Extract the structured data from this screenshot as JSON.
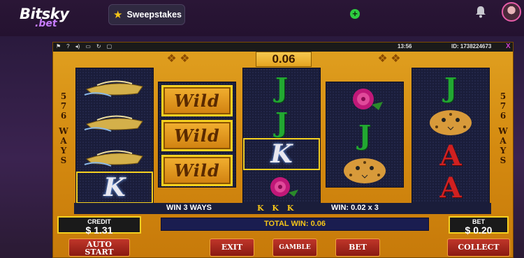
{
  "site": {
    "logo_main": "Bitsky",
    "logo_sub": ".bet",
    "sweepstakes_label": "Sweepstakes"
  },
  "game": {
    "topbar": {
      "flag": "⚑",
      "help": "?",
      "time": "13:56",
      "id": "ID: 1738224673",
      "close": "X"
    },
    "win_display": "0.06",
    "ways": [
      "5",
      "7",
      "6",
      "W",
      "A",
      "Y",
      "S"
    ],
    "reels": [
      [
        "boat",
        "boat",
        "boat",
        "K"
      ],
      [
        "Wild",
        "Wild",
        "Wild"
      ],
      [
        "J",
        "J",
        "K",
        "rose"
      ],
      [
        "rose",
        "J",
        "leopard"
      ],
      [
        "J",
        "leopard",
        "A",
        "A"
      ]
    ],
    "wild_text": "Wild",
    "info": {
      "win_ways": "WIN 3 WAYS",
      "symbols": "K K K",
      "win_calc": "WIN: 0.02 x 3"
    },
    "credit": {
      "label": "CREDIT",
      "value": "$ 1.31"
    },
    "bet": {
      "label": "BET",
      "value": "$ 0.20"
    },
    "total_win": "TOTAL WIN: 0.06",
    "buttons": {
      "auto_line1": "AUTO",
      "auto_line2": "START",
      "exit": "EXIT",
      "gamble": "GAMBLE",
      "bet": "BET",
      "collect": "COLLECT"
    }
  },
  "colors": {
    "frame": "#d48a10",
    "reel_bg": "#1a1d3a",
    "highlight": "#f5d020",
    "button": "#a82a1e"
  }
}
